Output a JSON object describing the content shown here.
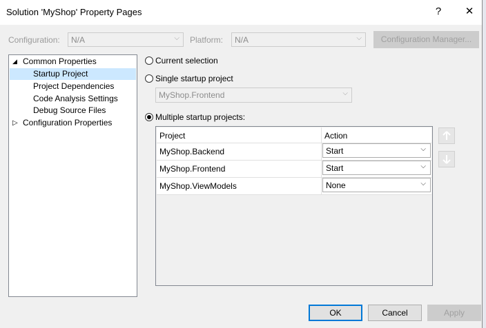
{
  "window": {
    "title": "Solution 'MyShop' Property Pages",
    "help_glyph": "?",
    "close_glyph": "✕"
  },
  "config_bar": {
    "configuration_label": "Configuration:",
    "configuration_value": "N/A",
    "platform_label": "Platform:",
    "platform_value": "N/A",
    "config_manager_label": "Configuration Manager..."
  },
  "tree": {
    "common_properties": "Common Properties",
    "startup_project": "Startup Project",
    "project_dependencies": "Project Dependencies",
    "code_analysis_settings": "Code Analysis Settings",
    "debug_source_files": "Debug Source Files",
    "configuration_properties": "Configuration Properties",
    "expanded_glyph": "◢",
    "collapsed_glyph": "▷"
  },
  "startup": {
    "current_selection": "Current selection",
    "single_startup_project": "Single startup project",
    "single_value": "MyShop.Frontend",
    "multiple_startup_projects": "Multiple startup projects:",
    "selected_option": "multiple"
  },
  "grid": {
    "headers": {
      "project": "Project",
      "action": "Action"
    },
    "rows": [
      {
        "project": "MyShop.Backend",
        "action": "Start"
      },
      {
        "project": "MyShop.Frontend",
        "action": "Start"
      },
      {
        "project": "MyShop.ViewModels",
        "action": "None"
      }
    ]
  },
  "icons": {
    "move_up": "arrow-up-icon",
    "move_down": "arrow-down-icon",
    "dropdown": "chevron-down-icon"
  },
  "footer": {
    "ok": "OK",
    "cancel": "Cancel",
    "apply": "Apply"
  },
  "colors": {
    "selection": "#cce8ff",
    "default_button_border": "#0078d7",
    "dialog_bg": "#f0f0f0"
  }
}
